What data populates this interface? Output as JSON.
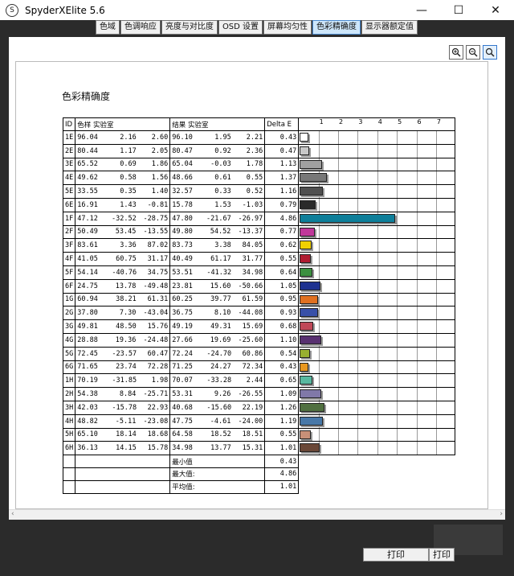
{
  "window": {
    "title": "SpyderXElite 5.6",
    "icon": "spyder-s-icon",
    "app_icon_letter": "S"
  },
  "tabs": [
    {
      "label": "色域",
      "active": false
    },
    {
      "label": "色调响应",
      "active": false
    },
    {
      "label": "亮度与对比度",
      "active": false
    },
    {
      "label": "OSD 设置",
      "active": false
    },
    {
      "label": "屏幕均匀性",
      "active": false
    },
    {
      "label": "色彩精确度",
      "active": true
    },
    {
      "label": "显示器额定值",
      "active": false
    }
  ],
  "zoom": {
    "icons": [
      "zoom-in-icon",
      "zoom-out-icon",
      "zoom-fit-icon"
    ]
  },
  "report": {
    "title": "色彩精确度",
    "headers": {
      "id": "ID",
      "reference": "色样 实验室",
      "result": "结果 实验室",
      "delta": "Delta E"
    },
    "scale_ticks": [
      "1",
      "2",
      "3",
      "4",
      "5",
      "6",
      "7"
    ],
    "scale_max": 8,
    "rows": [
      {
        "id": "1E",
        "ref": [
          "96.04",
          "2.16",
          "2.60"
        ],
        "res": [
          "96.10",
          "1.95",
          "2.21"
        ],
        "de": "0.43",
        "color": "#ffffff"
      },
      {
        "id": "2E",
        "ref": [
          "80.44",
          "1.17",
          "2.05"
        ],
        "res": [
          "80.47",
          "0.92",
          "2.36"
        ],
        "de": "0.47",
        "color": "#c8c8c8"
      },
      {
        "id": "3E",
        "ref": [
          "65.52",
          "0.69",
          "1.86"
        ],
        "res": [
          "65.04",
          "-0.03",
          "1.78"
        ],
        "de": "1.13",
        "color": "#a0a0a0"
      },
      {
        "id": "4E",
        "ref": [
          "49.62",
          "0.58",
          "1.56"
        ],
        "res": [
          "48.66",
          "0.61",
          "0.55"
        ],
        "de": "1.37",
        "color": "#787878"
      },
      {
        "id": "5E",
        "ref": [
          "33.55",
          "0.35",
          "1.40"
        ],
        "res": [
          "32.57",
          "0.33",
          "0.52"
        ],
        "de": "1.16",
        "color": "#505050"
      },
      {
        "id": "6E",
        "ref": [
          "16.91",
          "1.43",
          "-0.81"
        ],
        "res": [
          "15.78",
          "1.53",
          "-1.03"
        ],
        "de": "0.79",
        "color": "#2a2a2a"
      },
      {
        "id": "1F",
        "ref": [
          "47.12",
          "-32.52",
          "-28.75"
        ],
        "res": [
          "47.80",
          "-21.67",
          "-26.97"
        ],
        "de": "4.86",
        "color": "#0e7f9a"
      },
      {
        "id": "2F",
        "ref": [
          "50.49",
          "53.45",
          "-13.55"
        ],
        "res": [
          "49.80",
          "54.52",
          "-13.37"
        ],
        "de": "0.77",
        "color": "#c0389a"
      },
      {
        "id": "3F",
        "ref": [
          "83.61",
          "3.36",
          "87.02"
        ],
        "res": [
          "83.73",
          "3.38",
          "84.05"
        ],
        "de": "0.62",
        "color": "#f0d000"
      },
      {
        "id": "4F",
        "ref": [
          "41.05",
          "60.75",
          "31.17"
        ],
        "res": [
          "40.49",
          "61.17",
          "31.77"
        ],
        "de": "0.55",
        "color": "#b01c30"
      },
      {
        "id": "5F",
        "ref": [
          "54.14",
          "-40.76",
          "34.75"
        ],
        "res": [
          "53.51",
          "-41.32",
          "34.98"
        ],
        "de": "0.64",
        "color": "#3c9040"
      },
      {
        "id": "6F",
        "ref": [
          "24.75",
          "13.78",
          "-49.48"
        ],
        "res": [
          "23.81",
          "15.60",
          "-50.66"
        ],
        "de": "1.05",
        "color": "#1e3290"
      },
      {
        "id": "1G",
        "ref": [
          "60.94",
          "38.21",
          "61.31"
        ],
        "res": [
          "60.25",
          "39.77",
          "61.59"
        ],
        "de": "0.95",
        "color": "#e07020"
      },
      {
        "id": "2G",
        "ref": [
          "37.80",
          "7.30",
          "-43.04"
        ],
        "res": [
          "36.75",
          "8.10",
          "-44.08"
        ],
        "de": "0.93",
        "color": "#3850a8"
      },
      {
        "id": "3G",
        "ref": [
          "49.81",
          "48.50",
          "15.76"
        ],
        "res": [
          "49.19",
          "49.31",
          "15.69"
        ],
        "de": "0.68",
        "color": "#c04858"
      },
      {
        "id": "4G",
        "ref": [
          "28.88",
          "19.36",
          "-24.48"
        ],
        "res": [
          "27.66",
          "19.69",
          "-25.60"
        ],
        "de": "1.10",
        "color": "#583070"
      },
      {
        "id": "5G",
        "ref": [
          "72.45",
          "-23.57",
          "60.47"
        ],
        "res": [
          "72.24",
          "-24.70",
          "60.86"
        ],
        "de": "0.54",
        "color": "#98b030"
      },
      {
        "id": "6G",
        "ref": [
          "71.65",
          "23.74",
          "72.28"
        ],
        "res": [
          "71.25",
          "24.27",
          "72.34"
        ],
        "de": "0.43",
        "color": "#e89820"
      },
      {
        "id": "1H",
        "ref": [
          "70.19",
          "-31.85",
          "1.98"
        ],
        "res": [
          "70.07",
          "-33.28",
          "2.44"
        ],
        "de": "0.65",
        "color": "#58b8a0"
      },
      {
        "id": "2H",
        "ref": [
          "54.38",
          "8.84",
          "-25.71"
        ],
        "res": [
          "53.31",
          "9.26",
          "-26.55"
        ],
        "de": "1.09",
        "color": "#8078a8"
      },
      {
        "id": "3H",
        "ref": [
          "42.03",
          "-15.78",
          "22.93"
        ],
        "res": [
          "40.68",
          "-15.60",
          "22.19"
        ],
        "de": "1.26",
        "color": "#507040"
      },
      {
        "id": "4H",
        "ref": [
          "48.82",
          "-5.11",
          "-23.08"
        ],
        "res": [
          "47.75",
          "-4.61",
          "-24.00"
        ],
        "de": "1.19",
        "color": "#4878a8"
      },
      {
        "id": "5H",
        "ref": [
          "65.10",
          "18.14",
          "18.68"
        ],
        "res": [
          "64.58",
          "18.52",
          "18.51"
        ],
        "de": "0.55",
        "color": "#c89078"
      },
      {
        "id": "6H",
        "ref": [
          "36.13",
          "14.15",
          "15.78"
        ],
        "res": [
          "34.98",
          "13.77",
          "15.31"
        ],
        "de": "1.01",
        "color": "#6a4838"
      }
    ],
    "summary": [
      {
        "label": "最小值",
        "value": "0.43"
      },
      {
        "label": "最大值:",
        "value": "4.86"
      },
      {
        "label": "平均值:",
        "value": "1.01"
      }
    ]
  },
  "footer": {
    "print_label": "打印",
    "print_label_2": "打印"
  }
}
